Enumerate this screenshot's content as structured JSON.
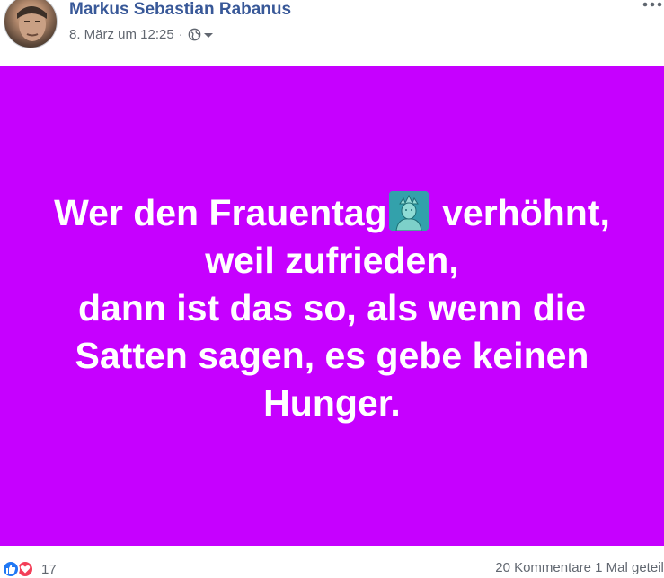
{
  "post": {
    "author": "Markus Sebastian Rabanus",
    "timestamp": "8. März um 12:25",
    "separator": "·",
    "audience_icon": "globe-icon",
    "background_color": "#c600ff",
    "lines": [
      "Wer den Frauentag",
      " verhöhnt,",
      "weil zufrieden,",
      "dann ist das so, als wenn die",
      "Satten sagen, es gebe keinen",
      "Hunger."
    ],
    "emoji": "statue-of-liberty-emoji"
  },
  "footer": {
    "reaction_count": "17",
    "stats": "20 Kommentare  1 Mal geteilt"
  }
}
